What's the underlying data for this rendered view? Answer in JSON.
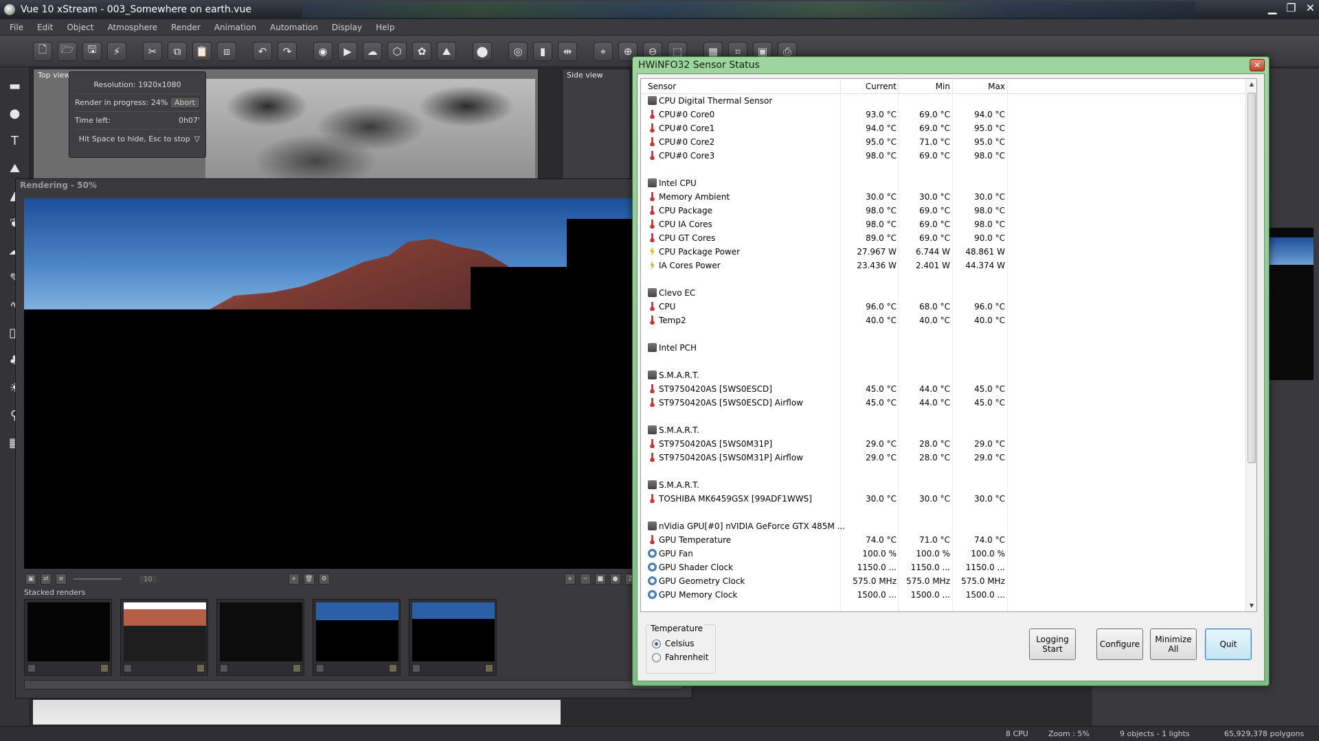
{
  "app": {
    "title": "Vue 10 xStream - 003_Somewhere on earth.vue",
    "menu": [
      "File",
      "Edit",
      "Object",
      "Atmosphere",
      "Render",
      "Animation",
      "Automation",
      "Display",
      "Help"
    ]
  },
  "viewports": {
    "top_label": "Top view",
    "side_label": "Side view"
  },
  "render_hud": {
    "resolution": "Resolution: 1920x1080",
    "progress_label": "Render in progress:",
    "progress_value": "24%",
    "abort": "Abort",
    "time_left_label": "Time left:",
    "time_left_value": "0h07'",
    "hint": "Hit Space to hide, Esc to stop"
  },
  "render_window": {
    "title": "Rendering - 50%",
    "frame_value": "10",
    "stacked_label": "Stacked renders"
  },
  "statusbar": {
    "cpu": "8 CPU",
    "zoom": "Zoom : 5%",
    "objects": "9 objects - 1 lights",
    "polygons": "65,929,378 polygons"
  },
  "hwinfo": {
    "title": "HWiNFO32 Sensor Status",
    "close": "✕",
    "columns": {
      "sensor": "Sensor",
      "current": "Current",
      "min": "Min",
      "max": "Max"
    },
    "rows": [
      {
        "type": "group",
        "name": "CPU Digital Thermal Sensor",
        "cur": "",
        "min": "",
        "max": ""
      },
      {
        "type": "temp",
        "name": "CPU#0 Core0",
        "cur": "93.0 °C",
        "min": "69.0 °C",
        "max": "94.0 °C"
      },
      {
        "type": "temp",
        "name": "CPU#0 Core1",
        "cur": "94.0 °C",
        "min": "69.0 °C",
        "max": "95.0 °C"
      },
      {
        "type": "temp",
        "name": "CPU#0 Core2",
        "cur": "95.0 °C",
        "min": "71.0 °C",
        "max": "95.0 °C"
      },
      {
        "type": "temp",
        "name": "CPU#0 Core3",
        "cur": "98.0 °C",
        "min": "69.0 °C",
        "max": "98.0 °C"
      },
      {
        "type": "blank",
        "name": "",
        "cur": "",
        "min": "",
        "max": ""
      },
      {
        "type": "group",
        "name": "Intel CPU",
        "cur": "",
        "min": "",
        "max": ""
      },
      {
        "type": "temp",
        "name": "Memory Ambient",
        "cur": "30.0 °C",
        "min": "30.0 °C",
        "max": "30.0 °C"
      },
      {
        "type": "temp",
        "name": "CPU Package",
        "cur": "98.0 °C",
        "min": "69.0 °C",
        "max": "98.0 °C"
      },
      {
        "type": "temp",
        "name": "CPU IA Cores",
        "cur": "98.0 °C",
        "min": "69.0 °C",
        "max": "98.0 °C"
      },
      {
        "type": "temp",
        "name": "CPU GT Cores",
        "cur": "89.0 °C",
        "min": "69.0 °C",
        "max": "90.0 °C"
      },
      {
        "type": "power",
        "name": "CPU Package Power",
        "cur": "27.967 W",
        "min": "6.744 W",
        "max": "48.861 W"
      },
      {
        "type": "power",
        "name": "IA Cores Power",
        "cur": "23.436 W",
        "min": "2.401 W",
        "max": "44.374 W"
      },
      {
        "type": "blank",
        "name": "",
        "cur": "",
        "min": "",
        "max": ""
      },
      {
        "type": "group",
        "name": "Clevo EC",
        "cur": "",
        "min": "",
        "max": ""
      },
      {
        "type": "temp",
        "name": "CPU",
        "cur": "96.0 °C",
        "min": "68.0 °C",
        "max": "96.0 °C"
      },
      {
        "type": "temp",
        "name": "Temp2",
        "cur": "40.0 °C",
        "min": "40.0 °C",
        "max": "40.0 °C"
      },
      {
        "type": "blank",
        "name": "",
        "cur": "",
        "min": "",
        "max": ""
      },
      {
        "type": "group",
        "name": "Intel PCH",
        "cur": "",
        "min": "",
        "max": ""
      },
      {
        "type": "blank",
        "name": "",
        "cur": "",
        "min": "",
        "max": ""
      },
      {
        "type": "group",
        "name": "S.M.A.R.T.",
        "cur": "",
        "min": "",
        "max": ""
      },
      {
        "type": "temp",
        "name": "ST9750420AS [5WS0ESCD]",
        "cur": "45.0 °C",
        "min": "44.0 °C",
        "max": "45.0 °C"
      },
      {
        "type": "temp",
        "name": "ST9750420AS [5WS0ESCD] Airflow",
        "cur": "45.0 °C",
        "min": "44.0 °C",
        "max": "45.0 °C"
      },
      {
        "type": "blank",
        "name": "",
        "cur": "",
        "min": "",
        "max": ""
      },
      {
        "type": "group",
        "name": "S.M.A.R.T.",
        "cur": "",
        "min": "",
        "max": ""
      },
      {
        "type": "temp",
        "name": "ST9750420AS [5WS0M31P]",
        "cur": "29.0 °C",
        "min": "28.0 °C",
        "max": "29.0 °C"
      },
      {
        "type": "temp",
        "name": "ST9750420AS [5WS0M31P] Airflow",
        "cur": "29.0 °C",
        "min": "28.0 °C",
        "max": "29.0 °C"
      },
      {
        "type": "blank",
        "name": "",
        "cur": "",
        "min": "",
        "max": ""
      },
      {
        "type": "group",
        "name": "S.M.A.R.T.",
        "cur": "",
        "min": "",
        "max": ""
      },
      {
        "type": "temp",
        "name": "TOSHIBA MK6459GSX [99ADF1WWS]",
        "cur": "30.0 °C",
        "min": "30.0 °C",
        "max": "30.0 °C"
      },
      {
        "type": "blank",
        "name": "",
        "cur": "",
        "min": "",
        "max": ""
      },
      {
        "type": "group",
        "name": "nVidia GPU[#0] nVIDIA GeForce GTX 485M ...",
        "cur": "",
        "min": "",
        "max": ""
      },
      {
        "type": "temp",
        "name": "GPU Temperature",
        "cur": "74.0 °C",
        "min": "71.0 °C",
        "max": "74.0 °C"
      },
      {
        "type": "gauge",
        "name": "GPU Fan",
        "cur": "100.0 %",
        "min": "100.0 %",
        "max": "100.0 %"
      },
      {
        "type": "gauge",
        "name": "GPU Shader Clock",
        "cur": "1150.0 ...",
        "min": "1150.0 ...",
        "max": "1150.0 ..."
      },
      {
        "type": "gauge",
        "name": "GPU Geometry Clock",
        "cur": "575.0 MHz",
        "min": "575.0 MHz",
        "max": "575.0 MHz"
      },
      {
        "type": "gauge",
        "name": "GPU Memory Clock",
        "cur": "1500.0 ...",
        "min": "1500.0 ...",
        "max": "1500.0 ..."
      }
    ],
    "temperature": {
      "legend": "Temperature",
      "celsius": "Celsius",
      "fahrenheit": "Fahrenheit",
      "selected": "Celsius"
    },
    "buttons": {
      "logging_line1": "Logging",
      "logging_line2": "Start",
      "configure": "Configure",
      "minimize_line1": "Minimize",
      "minimize_line2": "All",
      "quit": "Quit"
    }
  }
}
